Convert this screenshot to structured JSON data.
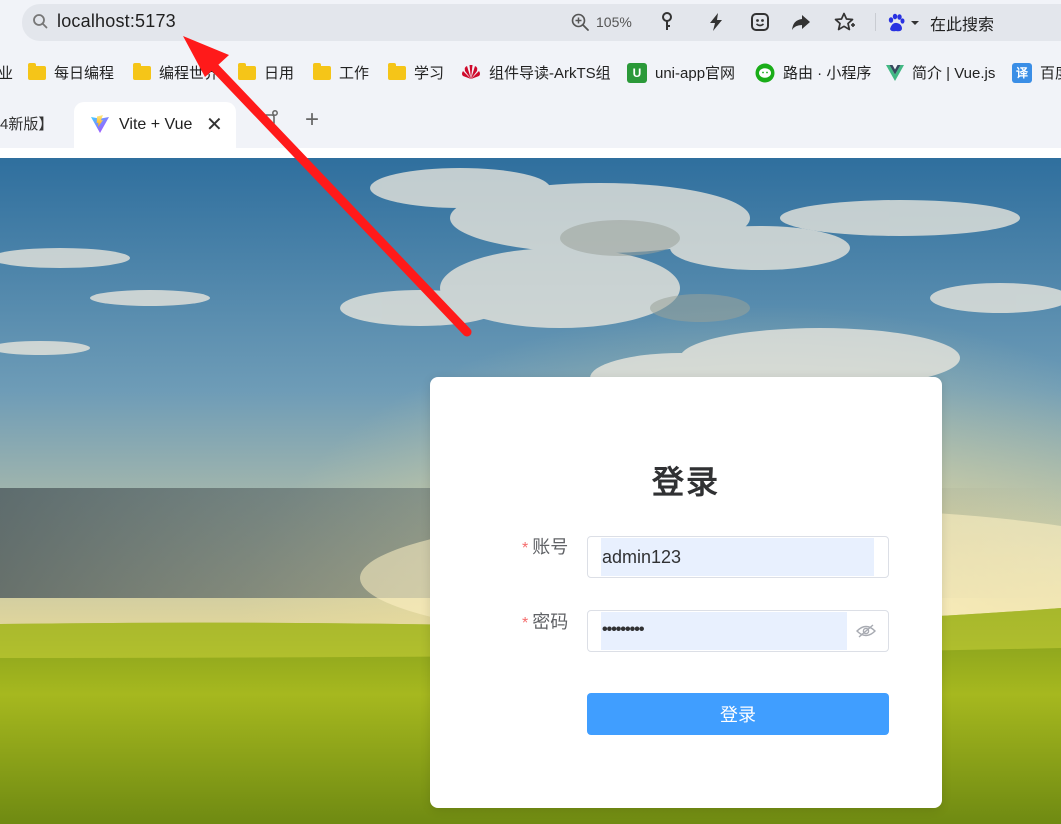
{
  "browser": {
    "url": "localhost:5173",
    "zoom": "105%",
    "search_engine_label": "在此搜索",
    "bookmarks": [
      {
        "label": "业",
        "icon": "none"
      },
      {
        "label": "每日编程",
        "icon": "folder-icon"
      },
      {
        "label": "编程世界",
        "icon": "folder-icon"
      },
      {
        "label": "日用",
        "icon": "folder-icon"
      },
      {
        "label": "工作",
        "icon": "folder-icon"
      },
      {
        "label": "学习",
        "icon": "folder-icon"
      },
      {
        "label": "组件导读-ArkTS组",
        "icon": "huawei-icon"
      },
      {
        "label": "uni-app官网",
        "icon": "uniapp-icon"
      },
      {
        "label": "路由 · 小程序",
        "icon": "wechat-icon"
      },
      {
        "label": "简介 | Vue.js",
        "icon": "vue-icon"
      },
      {
        "label": "百度",
        "icon": "translate-icon"
      }
    ],
    "tabs": {
      "previous_tab_fragment": "4新版】",
      "active_tab_title": "Vite + Vue",
      "close_glyph": "✕",
      "new_tab_glyph": "+"
    }
  },
  "login": {
    "title": "登录",
    "required_mark": "*",
    "account_label": "账号",
    "account_value": "admin123",
    "password_label": "密码",
    "password_masked": "•••••••••",
    "submit_label": "登录"
  },
  "colors": {
    "primary_button": "#409eff",
    "required_asterisk": "#f56c6c",
    "autofill_background": "#e8f0fe",
    "annotation_arrow": "#ff1a1a"
  }
}
